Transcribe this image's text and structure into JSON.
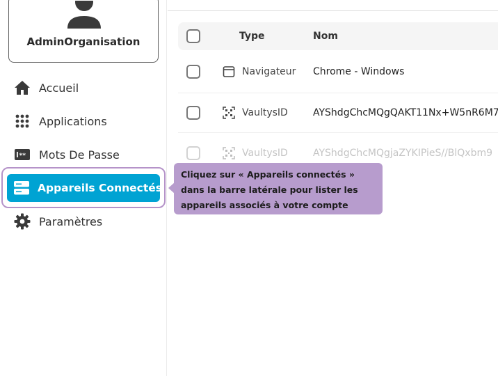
{
  "profile": {
    "name": "AdminOrganisation"
  },
  "sidebar": {
    "items": [
      {
        "label": "Accueil",
        "icon": "home-icon"
      },
      {
        "label": "Applications",
        "icon": "apps-grid-icon"
      },
      {
        "label": "Mots De Passe",
        "icon": "password-icon"
      },
      {
        "label": "Appareils Connectés",
        "icon": "devices-icon",
        "active": true
      },
      {
        "label": "Paramètres",
        "icon": "gear-icon"
      }
    ]
  },
  "tooltip": {
    "text": "Cliquez sur « Appareils connectés » dans la barre latérale pour lister les appareils associés à votre compte"
  },
  "table": {
    "headers": {
      "type": "Type",
      "name": "Nom"
    },
    "rows": [
      {
        "type": "Navigateur",
        "icon": "browser-window-icon",
        "name": "Chrome - Windows"
      },
      {
        "type": "VaultysID",
        "icon": "qr-scan-icon",
        "name": "AYShdgChcMQgQAKT11Nx+W5nR6M7"
      },
      {
        "type": "VaultysID",
        "icon": "qr-scan-icon",
        "name": "AYShdgChcMQgjaZYKIPieS//BlQxbm9"
      }
    ]
  },
  "colors": {
    "accent": "#00a3d3",
    "tooltip": "#b79ccd",
    "highlight": "#b593c9"
  }
}
